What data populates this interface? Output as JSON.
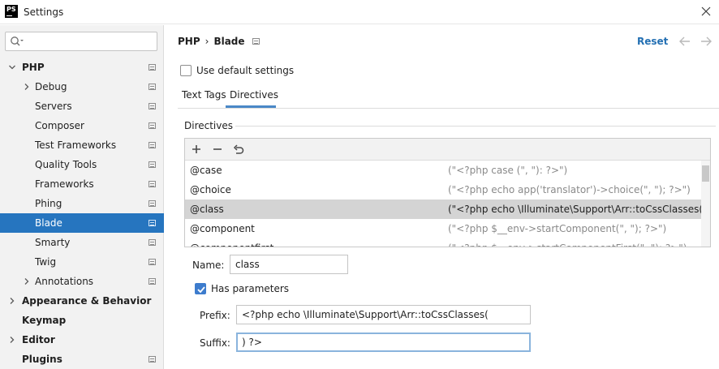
{
  "window": {
    "title": "Settings",
    "app_logo": "PS"
  },
  "sidebar": {
    "search": {
      "value": "",
      "placeholder": ""
    },
    "items": [
      {
        "label": "PHP",
        "bold": true,
        "expanded": true,
        "has_page_icon": true
      },
      {
        "label": "Debug",
        "collapsed_child": true,
        "has_page_icon": true
      },
      {
        "label": "Servers",
        "has_page_icon": true
      },
      {
        "label": "Composer",
        "has_page_icon": true
      },
      {
        "label": "Test Frameworks",
        "has_page_icon": true
      },
      {
        "label": "Quality Tools",
        "has_page_icon": true
      },
      {
        "label": "Frameworks",
        "has_page_icon": true
      },
      {
        "label": "Phing",
        "has_page_icon": true
      },
      {
        "label": "Blade",
        "selected": true,
        "has_page_icon": true
      },
      {
        "label": "Smarty",
        "has_page_icon": true
      },
      {
        "label": "Twig",
        "has_page_icon": true
      },
      {
        "label": "Annotations",
        "collapsed_child": true,
        "has_page_icon": true
      },
      {
        "label": "Appearance & Behavior",
        "bold": true,
        "collapsed": true
      },
      {
        "label": "Keymap",
        "bold": true
      },
      {
        "label": "Editor",
        "bold": true,
        "collapsed": true
      },
      {
        "label": "Plugins",
        "bold": true,
        "has_page_icon": true
      }
    ]
  },
  "header": {
    "breadcrumb": [
      "PHP",
      "Blade"
    ],
    "reset_label": "Reset"
  },
  "settings": {
    "use_default_label": "Use default settings",
    "use_default_checked": false,
    "tabs": [
      {
        "label": "Text Tags",
        "active": false
      },
      {
        "label": "Directives",
        "active": true
      }
    ],
    "directives_section_label": "Directives",
    "directives": [
      {
        "name": "@case",
        "value": "(\"<?php case (\", \"): ?>\")"
      },
      {
        "name": "@choice",
        "value": "(\"<?php echo app('translator')->choice(\", \"); ?>\")"
      },
      {
        "name": "@class",
        "value": "(\"<?php echo \\Illuminate\\Support\\Arr::toCssClasses(\", \") ?>",
        "selected": true
      },
      {
        "name": "@component",
        "value": "(\"<?php $__env->startComponent(\", \"); ?>\")"
      },
      {
        "name": "@componentfirst",
        "value": "(\"<?php $__env->startComponentFirst(\", \"); ?>\")"
      }
    ],
    "name_label": "Name:",
    "name_value": "class",
    "has_parameters_label": "Has parameters",
    "has_parameters_checked": true,
    "prefix_label": "Prefix:",
    "prefix_value": "<?php echo \\Illuminate\\Support\\Arr::toCssClasses(",
    "suffix_label": "Suffix:",
    "suffix_value": ") ?>"
  },
  "colors": {
    "selection": "#2675bf",
    "link": "#2470b3",
    "checkbox_checked": "#3d7ccd"
  }
}
